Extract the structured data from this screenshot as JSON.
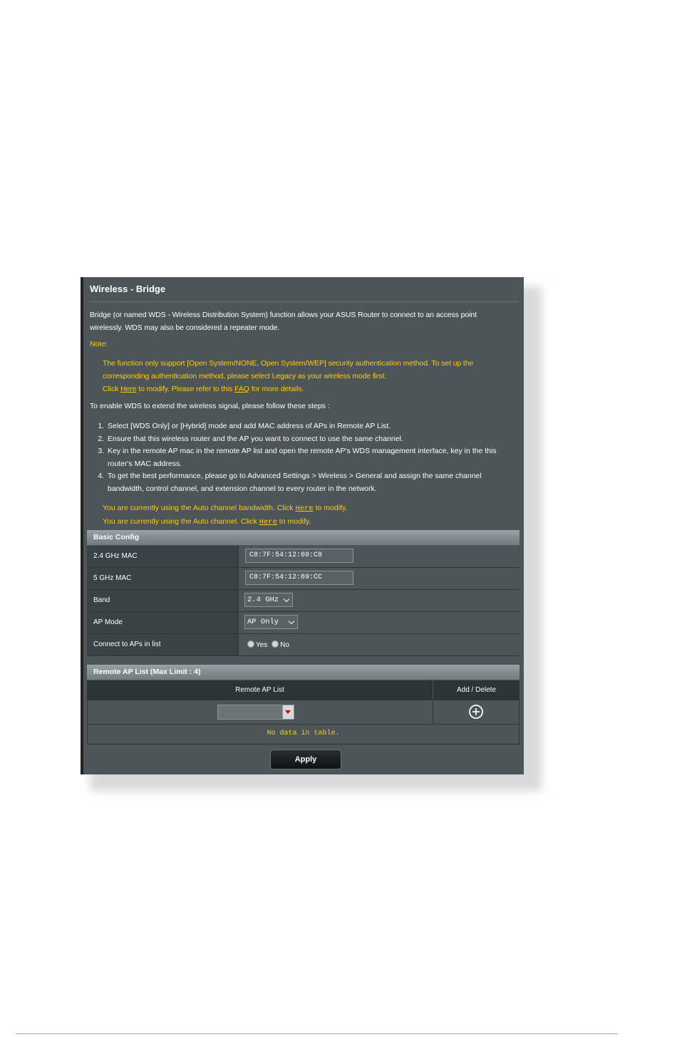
{
  "page": {
    "title": "Wireless - Bridge",
    "description": "Bridge (or named WDS - Wireless Distribution System) function allows your ASUS Router to connect to an access point wirelessly. WDS may also be considered a repeater mode.",
    "note_label": "Note:",
    "note_line1": "The function only support [Open System/NONE, Open System/WEP] security authentication method. To set up the corresponding authentication method, please select Legacy as your wireless mode first.",
    "note_click": "Click ",
    "note_here": "Here",
    "note_mid": " to modify. Please refer to this ",
    "note_faq": "FAQ",
    "note_end": " for more details.",
    "steps_intro": "To enable WDS to extend the wireless signal, please follow these steps :",
    "steps": [
      "Select [WDS Only] or [Hybrid] mode and add MAC address of APs in Remote AP List.",
      "Ensure that this wireless router and the AP you want to connect to use the same channel.",
      "Key in the remote AP mac in the remote AP list and open the remote AP's WDS management interface, key in the this router's MAC address.",
      "To get the best performance, please go to Advanced Settings > Wireless > General and assign the same channel bandwidth, control channel, and extension channel to every router in the network."
    ],
    "auto_bw_prefix": "You are currently using the Auto channel bandwidth. Click ",
    "auto_bw_here": "Here",
    "auto_bw_suffix": " to modify.",
    "auto_ch_prefix": "You are currently using the Auto channel. Click ",
    "auto_ch_here": "Here",
    "auto_ch_suffix": " to modify."
  },
  "basic_config": {
    "header": "Basic Config",
    "mac24_label": "2.4 GHz MAC",
    "mac24_value": "C8:7F:54:12:69:C8",
    "mac5_label": "5 GHz MAC",
    "mac5_value": "C8:7F:54:12:69:CC",
    "band_label": "Band",
    "band_value": "2.4 GHz",
    "ap_mode_label": "AP Mode",
    "ap_mode_value": "AP Only",
    "connect_label": "Connect to APs in list",
    "connect_yes": "Yes",
    "connect_no": "No"
  },
  "remote_ap": {
    "header": "Remote AP List (Max Limit : 4)",
    "col_list": "Remote AP List",
    "col_add": "Add / Delete",
    "empty": "No data in table."
  },
  "apply_label": "Apply",
  "colors": {
    "panel_bg": "#4d5558",
    "highlight": "#ffcc00"
  }
}
